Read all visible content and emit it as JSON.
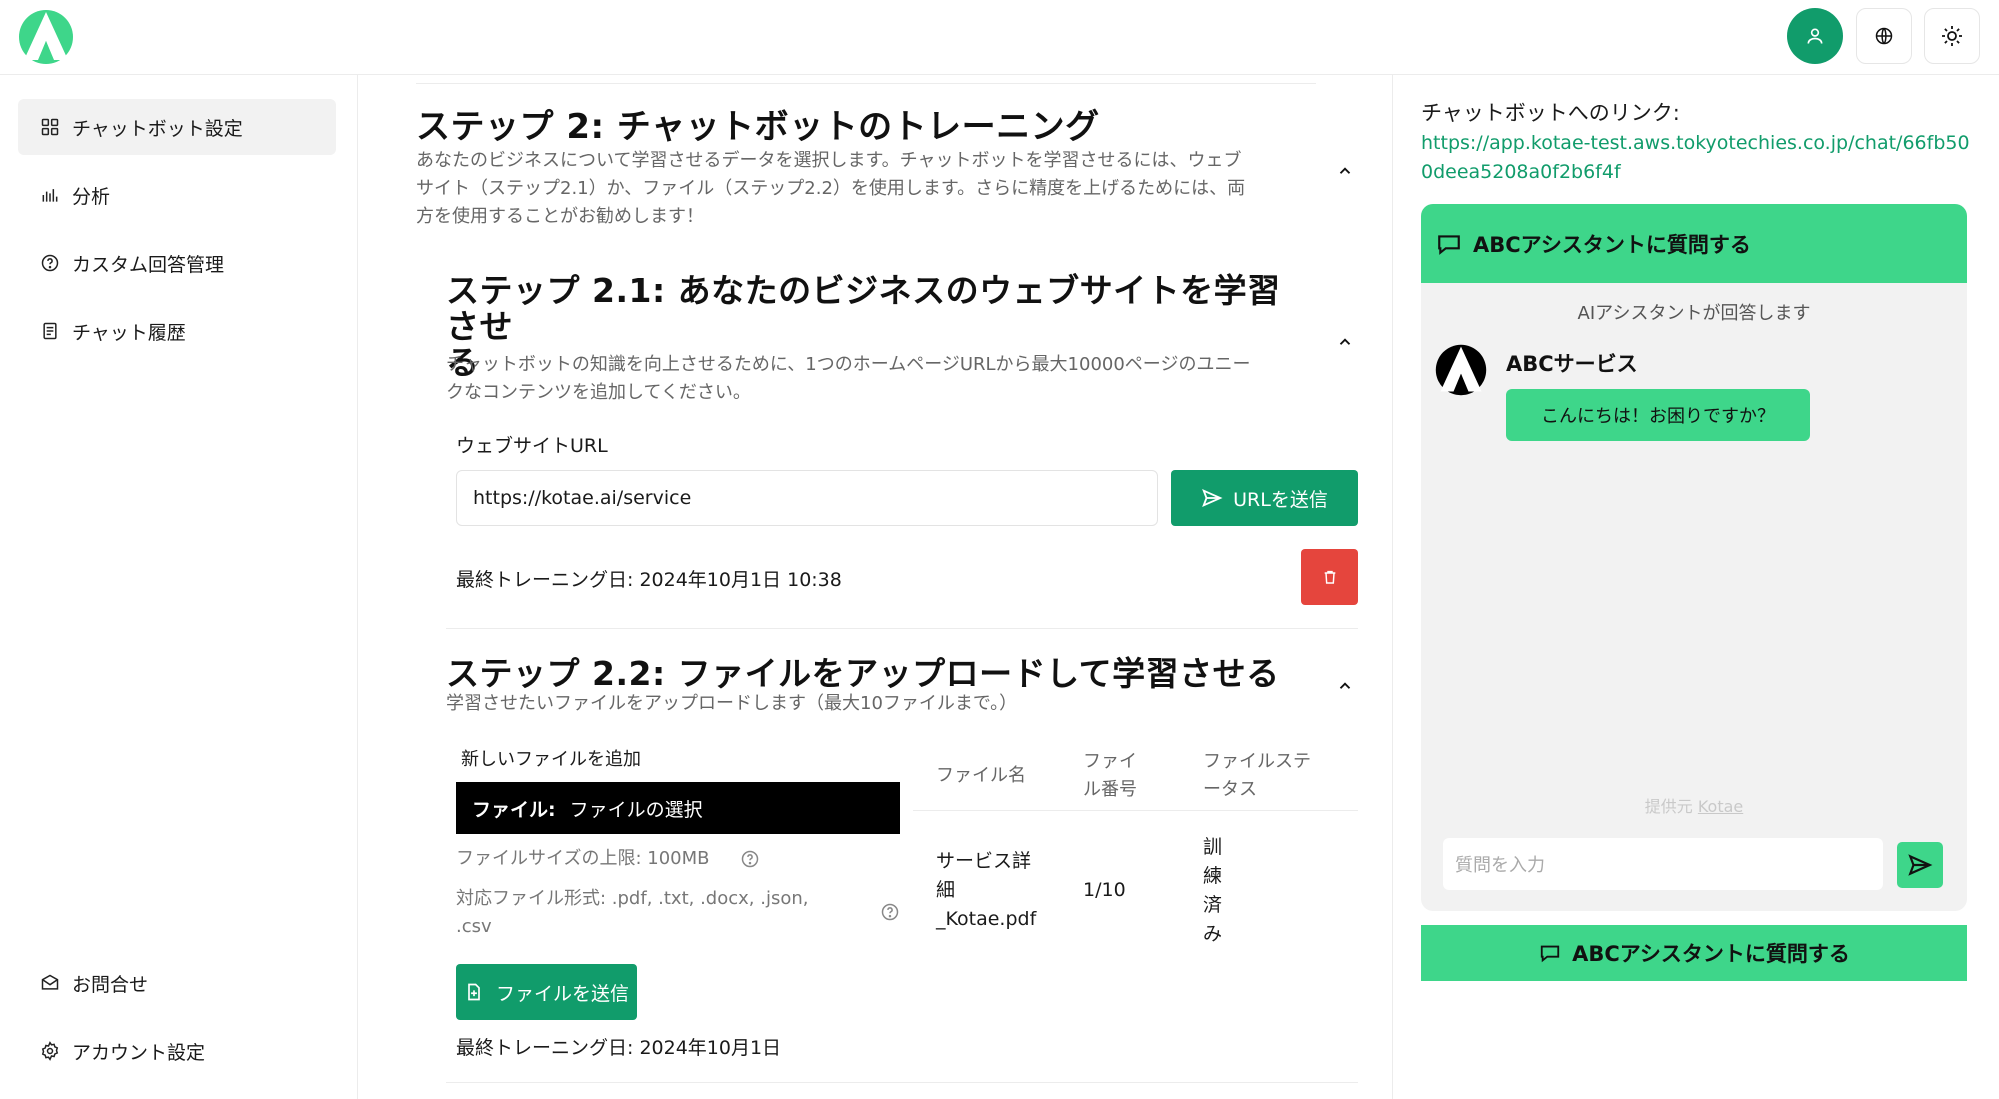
{
  "colors": {
    "brand_green": "#119c6b",
    "accent_green": "#3ed68a",
    "danger": "#e5453d"
  },
  "header": {
    "logo_icon": "kotae-logo",
    "buttons": [
      "user-icon",
      "globe-icon",
      "sun-icon"
    ]
  },
  "sidebar": {
    "items": [
      {
        "label": "チャットボット設定",
        "icon": "grid-icon",
        "active": true
      },
      {
        "label": "分析",
        "icon": "bar-chart-icon"
      },
      {
        "label": "カスタム回答管理",
        "icon": "help-circle-icon"
      },
      {
        "label": "チャット履歴",
        "icon": "document-icon"
      }
    ],
    "bottom_items": [
      {
        "label": "お問合せ",
        "icon": "mail-icon"
      },
      {
        "label": "アカウント設定",
        "icon": "gear-icon"
      }
    ]
  },
  "step2": {
    "title": "ステップ 2: チャットボットのトレーニング",
    "desc_line1": "あなたのビジネスについて学習させるデータを選択します。チャットボットを学習させるには、ウェブ",
    "desc_line2": "サイト（ステップ2.1）か、ファイル（ステップ2.2）を使用します。さらに精度を上げるためには、両",
    "desc_line3": "方を使用することがお勧めします！"
  },
  "step21": {
    "title_line1": "ステップ 2.1: あなたのビジネスのウェブサイトを学習させ",
    "title_line2": "る",
    "desc_line1": "チャットボットの知識を向上させるために、1つのホームページURLから最大10000ページのユニー",
    "desc_line2": "クなコンテンツを追加してください。",
    "url_label": "ウェブサイトURL",
    "url_value": "https://kotae.ai/service",
    "send_label": "URLを送信",
    "last_trained": "最終トレーニング日: 2024年10月1日 10:38"
  },
  "step22": {
    "title": "ステップ 2.2: ファイルをアップロードして学習させる",
    "desc": "学習させたいファイルをアップロードします（最大10ファイルまで。）",
    "add_label": "新しいファイルを追加",
    "file_prefix": "ファイル:",
    "file_choose": "ファイルの選択",
    "size_limit": "ファイルサイズの上限: 100MB",
    "formats_line1": "対応ファイル形式: .pdf, .txt, .docx, .json,",
    "formats_line2": ".csv",
    "send_label": "ファイルを送信",
    "last_trained": "最終トレーニング日: 2024年10月1日",
    "table": {
      "headers": {
        "name": "ファイル名",
        "num_line1": "ファイ",
        "num_line2": "ル番号",
        "status_line1": "ファイルステ",
        "status_line2": "ータス"
      },
      "rows": [
        {
          "name_line1": "サービス詳",
          "name_line2": "細",
          "name_line3": "_Kotae.pdf",
          "num": "1/10",
          "status_1": "訓",
          "status_2": "練",
          "status_3": "済",
          "status_4": "み"
        }
      ]
    }
  },
  "right": {
    "link_label": "チャットボットへのリンク:",
    "link_url": "https://app.kotae-test.aws.tokyotechies.co.jp/chat/66fb500deea5208a0f2b6f4f",
    "widget": {
      "head_title": "ABCアシスタントに質問する",
      "assist_note": "AIアシスタントが回答します",
      "bot_name": "ABCサービス",
      "greeting": "こんにちは！お困りですか？",
      "powered_prefix": "提供元",
      "powered_link": "Kotae",
      "input_placeholder": "質問を入力"
    },
    "bottom_button": "ABCアシスタントに質問する"
  }
}
